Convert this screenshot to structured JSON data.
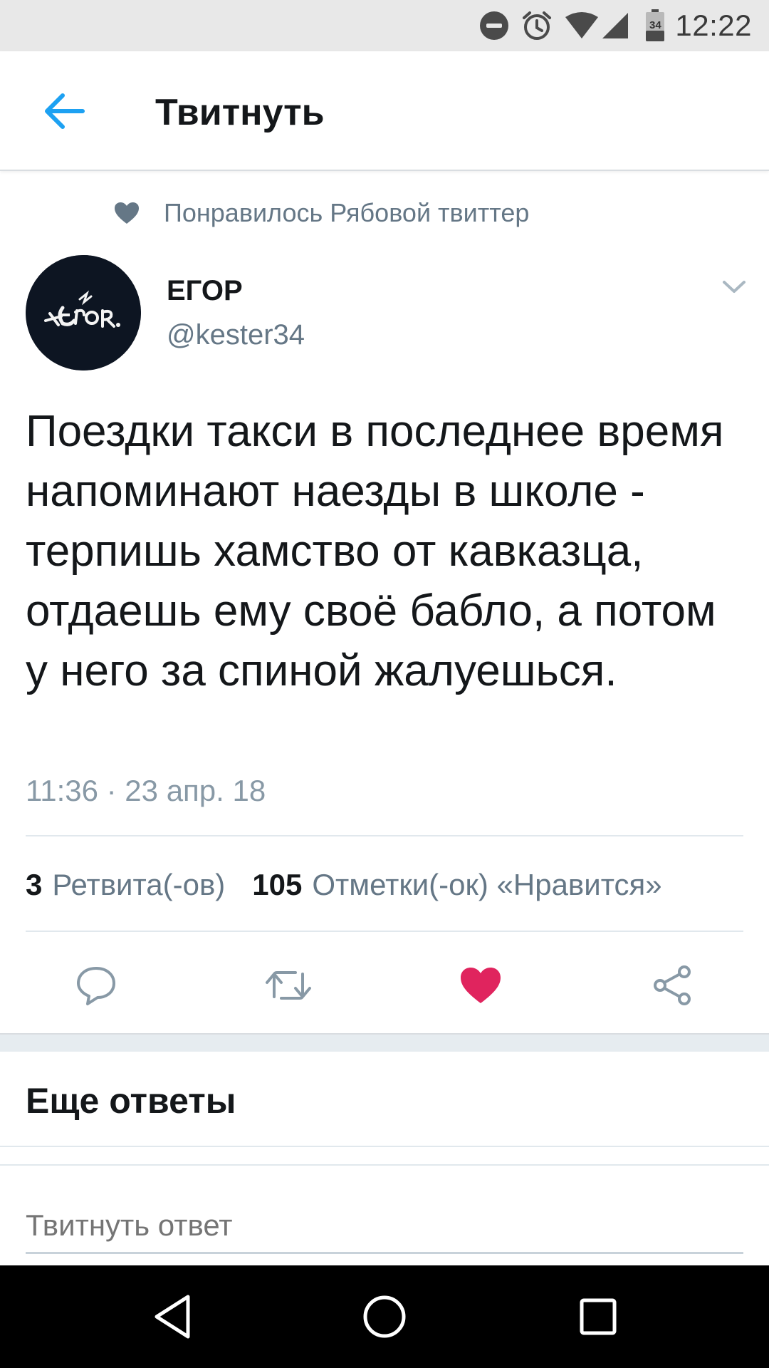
{
  "status_bar": {
    "time": "12:22",
    "battery_level": "34",
    "icons": [
      "do-not-disturb-icon",
      "alarm-icon",
      "wifi-icon",
      "cell-signal-icon",
      "battery-icon"
    ]
  },
  "app_bar": {
    "title": "Твитнуть",
    "back_icon": "arrow-left-icon"
  },
  "tweet": {
    "social_context": "Понравилось Рябовой твиттер",
    "author": {
      "name": "ЕГОР",
      "handle": "@kester34",
      "avatar_text": "Егор"
    },
    "text": "Поездки такси в последнее время напоминают наезды в школе - терпишь хамство от кавказца, отдаешь ему своё бабло, а потом у него за спиной жалуешься.",
    "timestamp": "11:36 · 23 апр. 18",
    "stats": {
      "retweets_count": "3",
      "retweets_label": "Ретвита(-ов)",
      "likes_count": "105",
      "likes_label": "Отметки(-ок) «Нравится»"
    },
    "liked": true
  },
  "colors": {
    "accent": "#1da1f2",
    "like": "#e0245e",
    "secondary_text": "#657786",
    "icon_gray": "#8899a6"
  },
  "replies": {
    "heading": "Еще ответы",
    "input_placeholder": "Твитнуть ответ"
  },
  "nav_bar": {
    "buttons": [
      "back-triangle-icon",
      "home-circle-icon",
      "recents-square-icon"
    ]
  }
}
